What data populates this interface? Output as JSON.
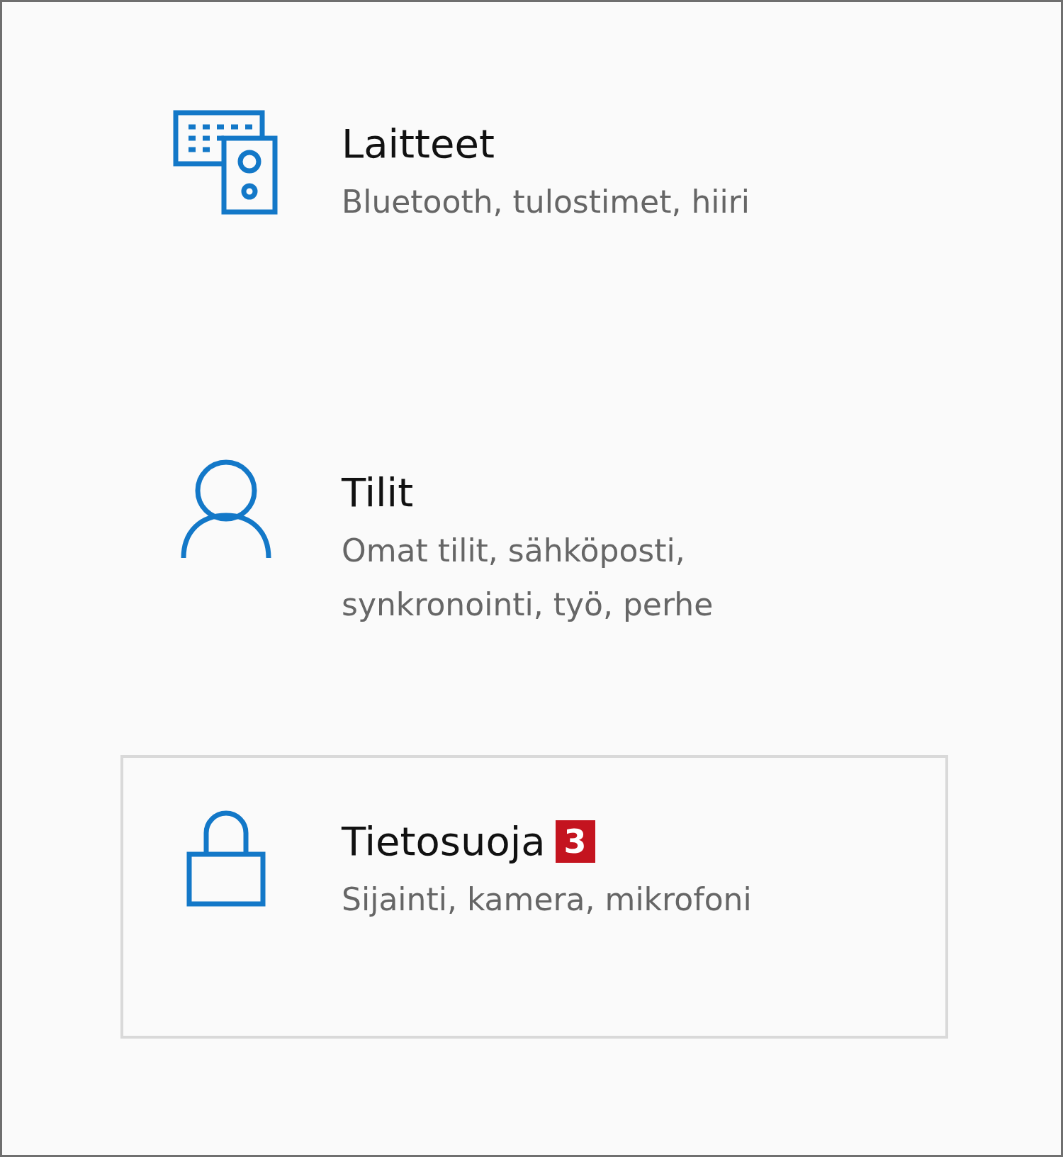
{
  "items": [
    {
      "kind": "devices",
      "title": "Laitteet",
      "subtitle": "Bluetooth, tulostimet, hiiri",
      "selected": false
    },
    {
      "kind": "accounts",
      "title": "Tilit",
      "subtitle": "Omat tilit, sähköposti, synkronointi, työ, perhe",
      "selected": false
    },
    {
      "kind": "privacy",
      "title": "Tietosuoja",
      "badge": "3",
      "subtitle": "Sijainti, kamera, mikrofoni",
      "selected": true
    }
  ]
}
